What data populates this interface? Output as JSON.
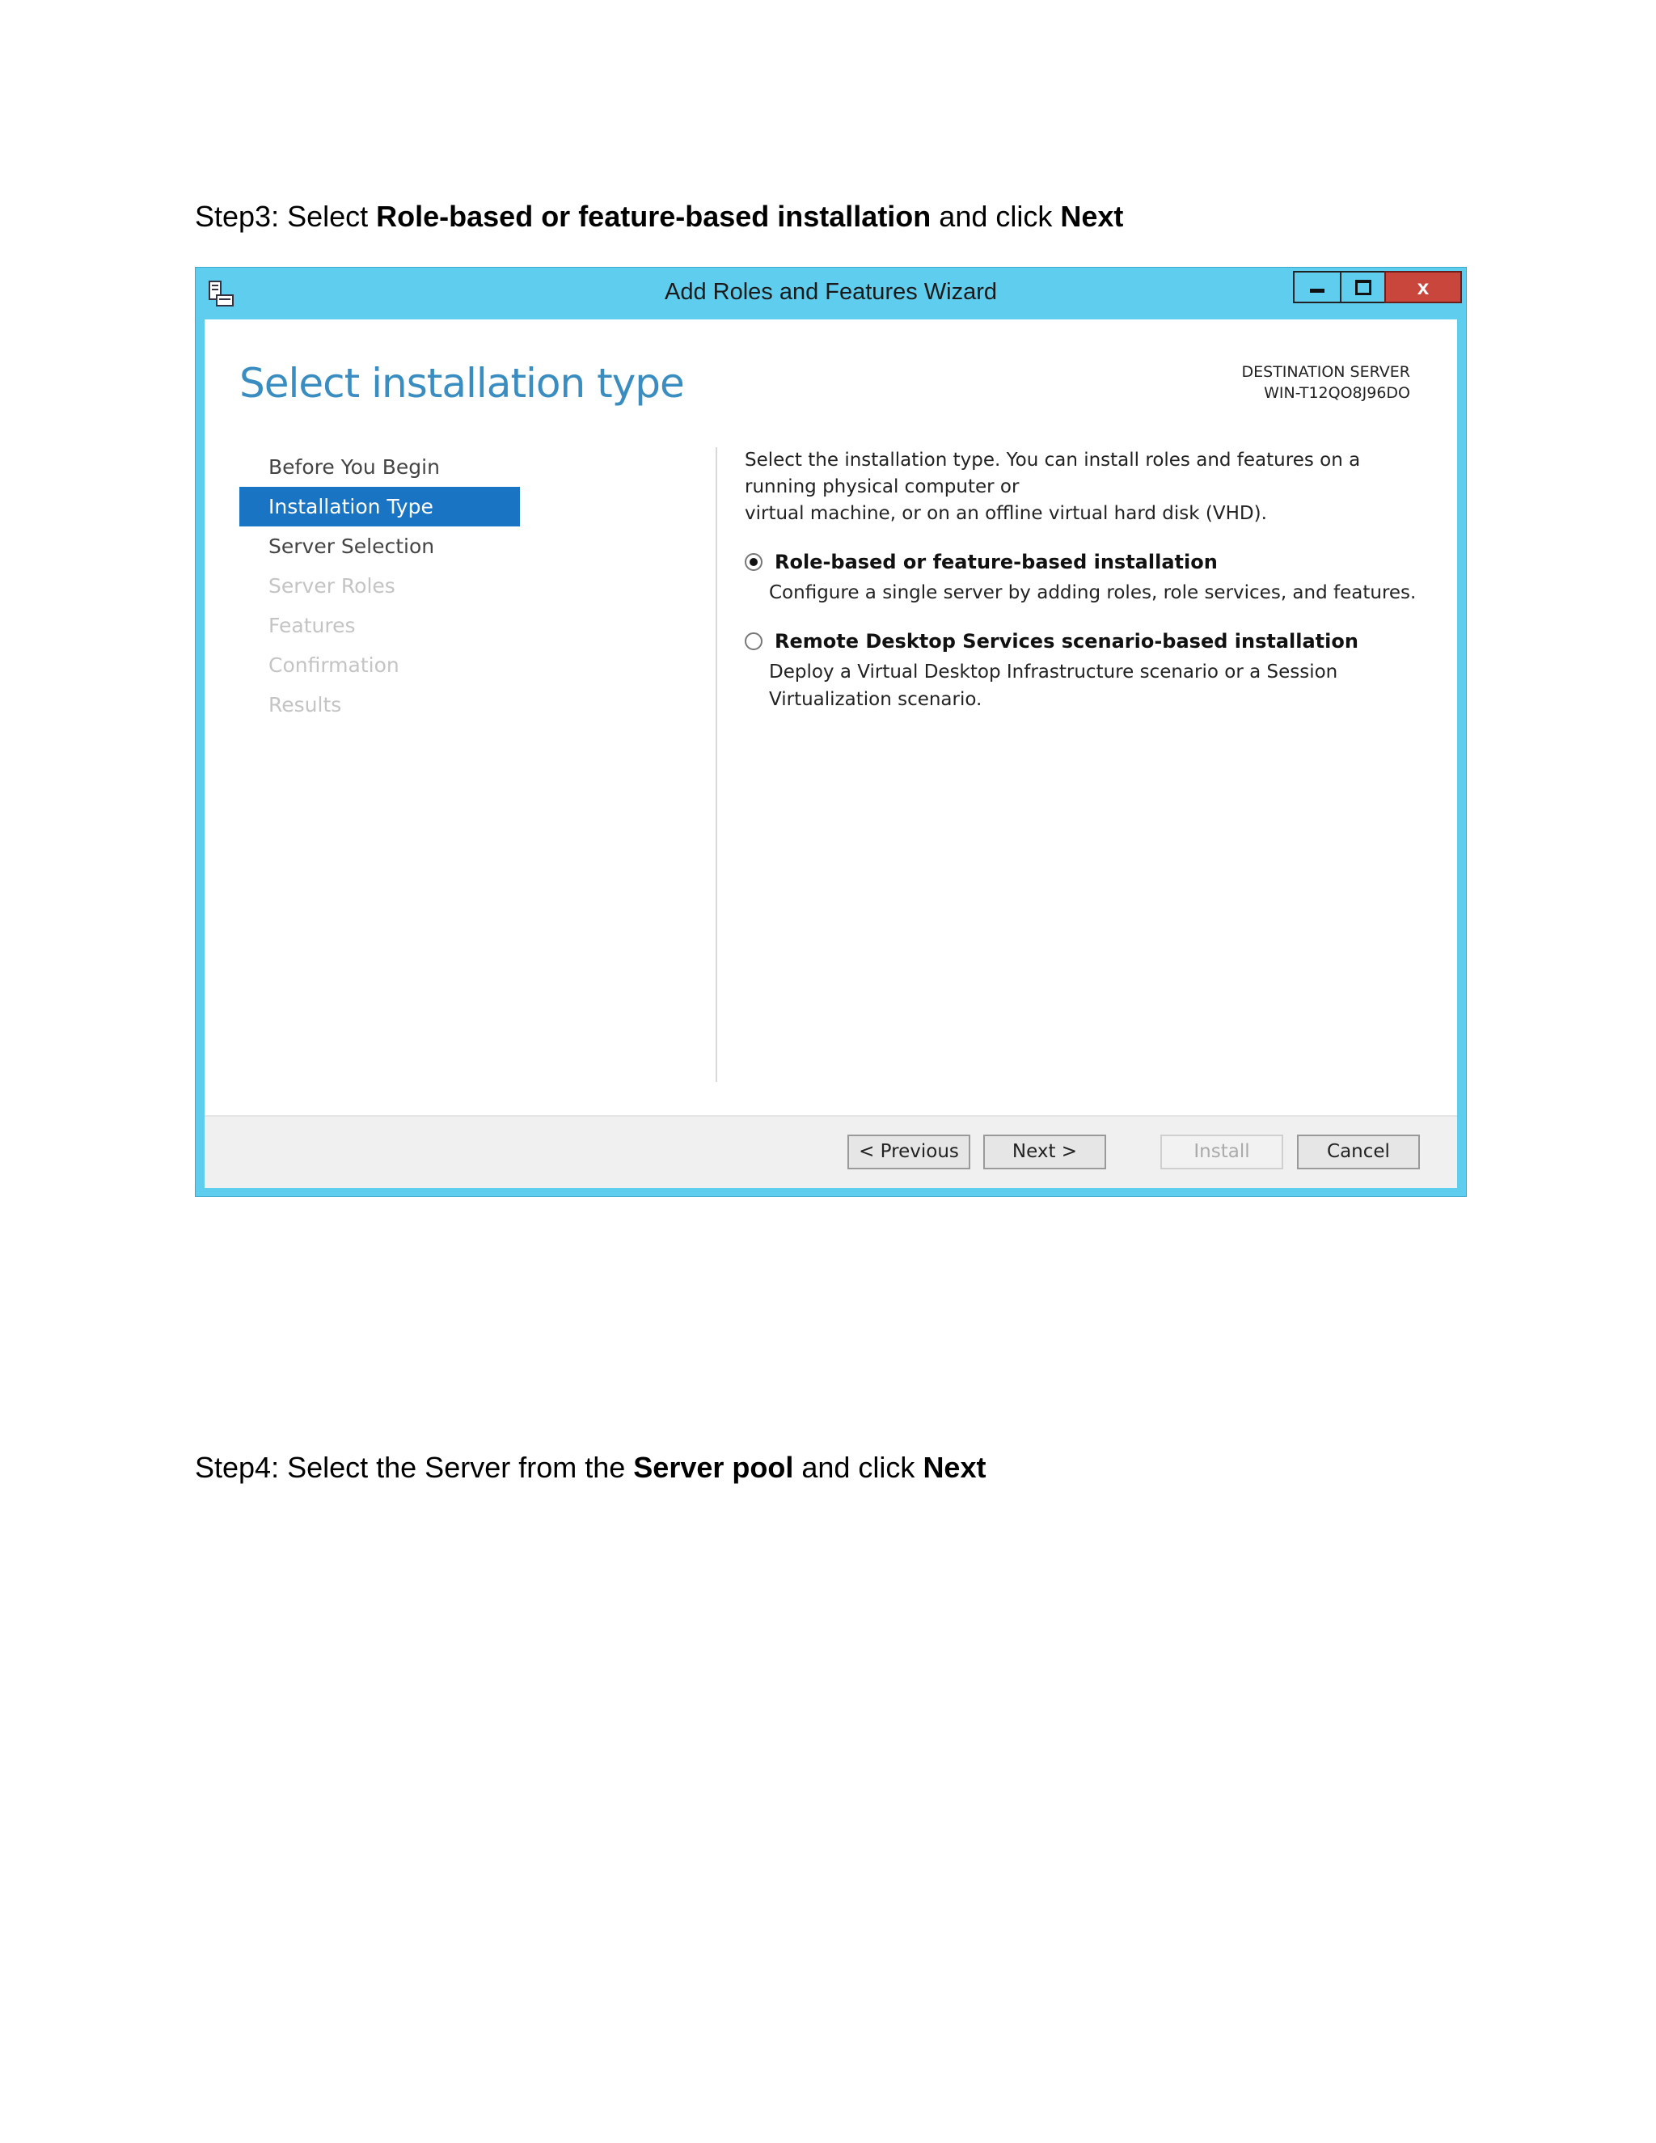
{
  "step3": {
    "prefix": "Step3: Select ",
    "bold1": "Role-based or feature-based installation",
    "mid": " and click ",
    "bold2": "Next"
  },
  "step4": {
    "prefix": "Step4: Select the Server from the ",
    "bold1": "Server pool",
    "mid": " and click ",
    "bold2": "Next"
  },
  "wizard": {
    "title": "Add Roles and Features Wizard",
    "close_glyph": "x",
    "heading": "Select installation type",
    "destination_label": "DESTINATION SERVER",
    "destination_server": "WIN-T12QO8J96DO",
    "nav": [
      {
        "label": "Before You Begin",
        "state": "normal"
      },
      {
        "label": "Installation Type",
        "state": "active"
      },
      {
        "label": "Server Selection",
        "state": "normal"
      },
      {
        "label": "Server Roles",
        "state": "disabled"
      },
      {
        "label": "Features",
        "state": "disabled"
      },
      {
        "label": "Confirmation",
        "state": "disabled"
      },
      {
        "label": "Results",
        "state": "disabled"
      }
    ],
    "intro_line1": "Select the installation type. You can install roles and features on a running physical computer or",
    "intro_line2": "virtual machine, or on an offline virtual hard disk (VHD).",
    "options": [
      {
        "label": "Role-based or feature-based installation",
        "description": "Configure a single server by adding roles, role services, and features.",
        "selected": true
      },
      {
        "label": "Remote Desktop Services scenario-based installation",
        "description": "Deploy a Virtual Desktop Infrastructure scenario or a Session Virtualization scenario.",
        "selected": false
      }
    ],
    "buttons": {
      "previous": "< Previous",
      "next": "Next >",
      "install": "Install",
      "cancel": "Cancel"
    },
    "colors": {
      "frame": "#5fcdee",
      "heading": "#3a8dc0",
      "nav_active": "#1a74c4",
      "close": "#c9463d"
    }
  }
}
